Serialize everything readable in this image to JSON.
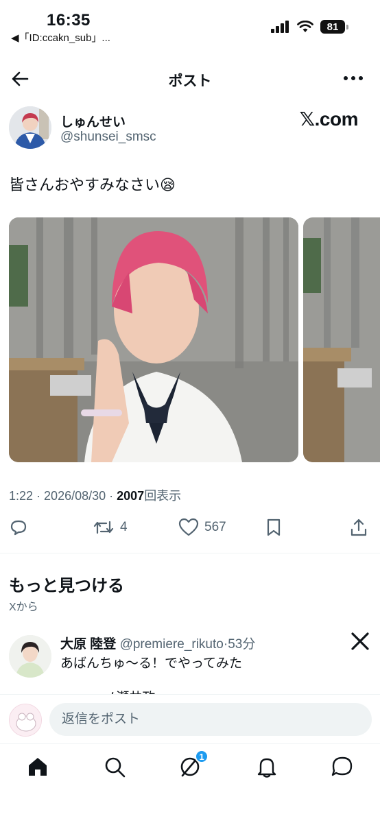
{
  "status_bar": {
    "time": "16:35",
    "back_app": "◀「ID:ccakn_sub」...",
    "battery": "81",
    "icons": [
      "signal-icon",
      "wifi-icon",
      "battery-icon"
    ]
  },
  "header": {
    "title": "ポスト",
    "back_icon": "arrow-left-icon",
    "more_icon": "more-horizontal-icon"
  },
  "post": {
    "author_name": "しゅんせい",
    "author_handle": "@shunsei_smsc",
    "source_label": "𝕏.com",
    "text": "皆さんおやすみなさい😪",
    "time": "1:22",
    "sep1": " · ",
    "date": "2026/08/30",
    "sep2": " · ",
    "views": "2007",
    "views_label": "回表示",
    "reposts": "4",
    "likes": "567"
  },
  "discover": {
    "title": "もっと見つける",
    "subtitle": "Xから"
  },
  "recommendation": {
    "name": "大原 陸登",
    "handle": "@premiere_rikuto",
    "sep": "·",
    "time": "53分",
    "text": "あばんちゅ〜る！でやってみた",
    "partial_line": "ー ー・ノ瀬共政"
  },
  "composer": {
    "placeholder": "返信をポスト"
  },
  "tabbar": {
    "items": [
      "home-icon",
      "search-icon",
      "grok-icon",
      "notifications-icon",
      "messages-icon"
    ],
    "badge": "1"
  },
  "colors": {
    "accent": "#1d9bf0",
    "text": "#0f1419",
    "muted": "#536471",
    "divider": "#eff3f4"
  }
}
